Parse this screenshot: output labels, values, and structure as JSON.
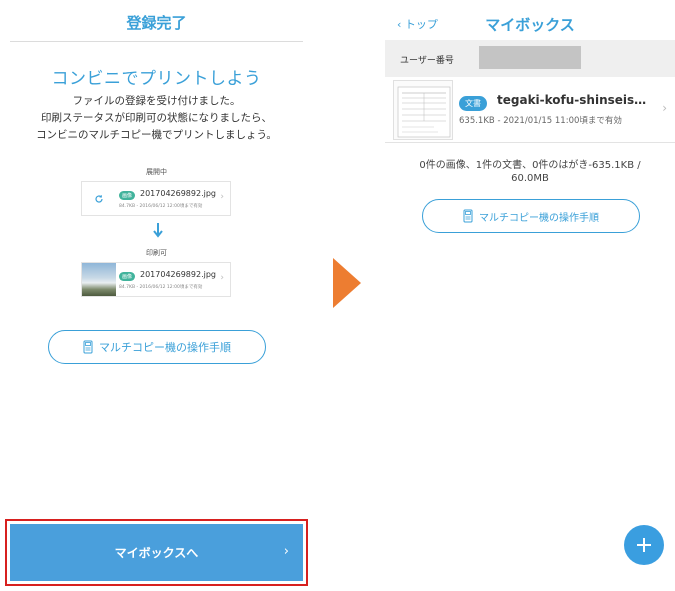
{
  "left_screen": {
    "title": "登録完了",
    "heading": "コンビニでプリントしよう",
    "description": [
      "ファイルの登録を受け付けました。",
      "印刷ステータスが印刷可の状態になりましたら、",
      "コンビニのマルチコピー機でプリントしましょう。"
    ],
    "stage_processing": {
      "label": "展開中",
      "badge": "画像",
      "filename": "201704269892.jpg",
      "meta": "84.7KB - 2016/06/12 12:00頃まで有効"
    },
    "stage_printable": {
      "label": "印刷可",
      "badge": "画像",
      "filename": "201704269892.jpg",
      "meta": "84.7KB - 2016/06/12 12:00頃まで有効"
    },
    "guide_button": "マルチコピー機の操作手順",
    "mybox_button": "マイボックスへ"
  },
  "right_screen": {
    "back_label": "トップ",
    "title": "マイボックス",
    "user_number_label": "ユーザー番号",
    "document": {
      "badge": "文書",
      "filename": "tegaki-kofu-shinseisho.…",
      "meta": "635.1KB - 2021/01/15 11:00頃まで有効"
    },
    "summary_line1": "0件の画像、1件の文書、0件のはがき-635.1KB /",
    "summary_line2": "60.0MB",
    "guide_button": "マルチコピー機の操作手順"
  },
  "colors": {
    "accent_blue": "#3aa0d8",
    "badge_green": "#41b39c",
    "highlight_red": "#d7201f",
    "flow_arrow": "#ed7d31"
  },
  "icons": {
    "processing": "refresh-icon",
    "down_arrow": "arrow-down-icon",
    "copier": "copier-icon",
    "chevron": "chevron-right-icon",
    "add": "plus-icon"
  }
}
